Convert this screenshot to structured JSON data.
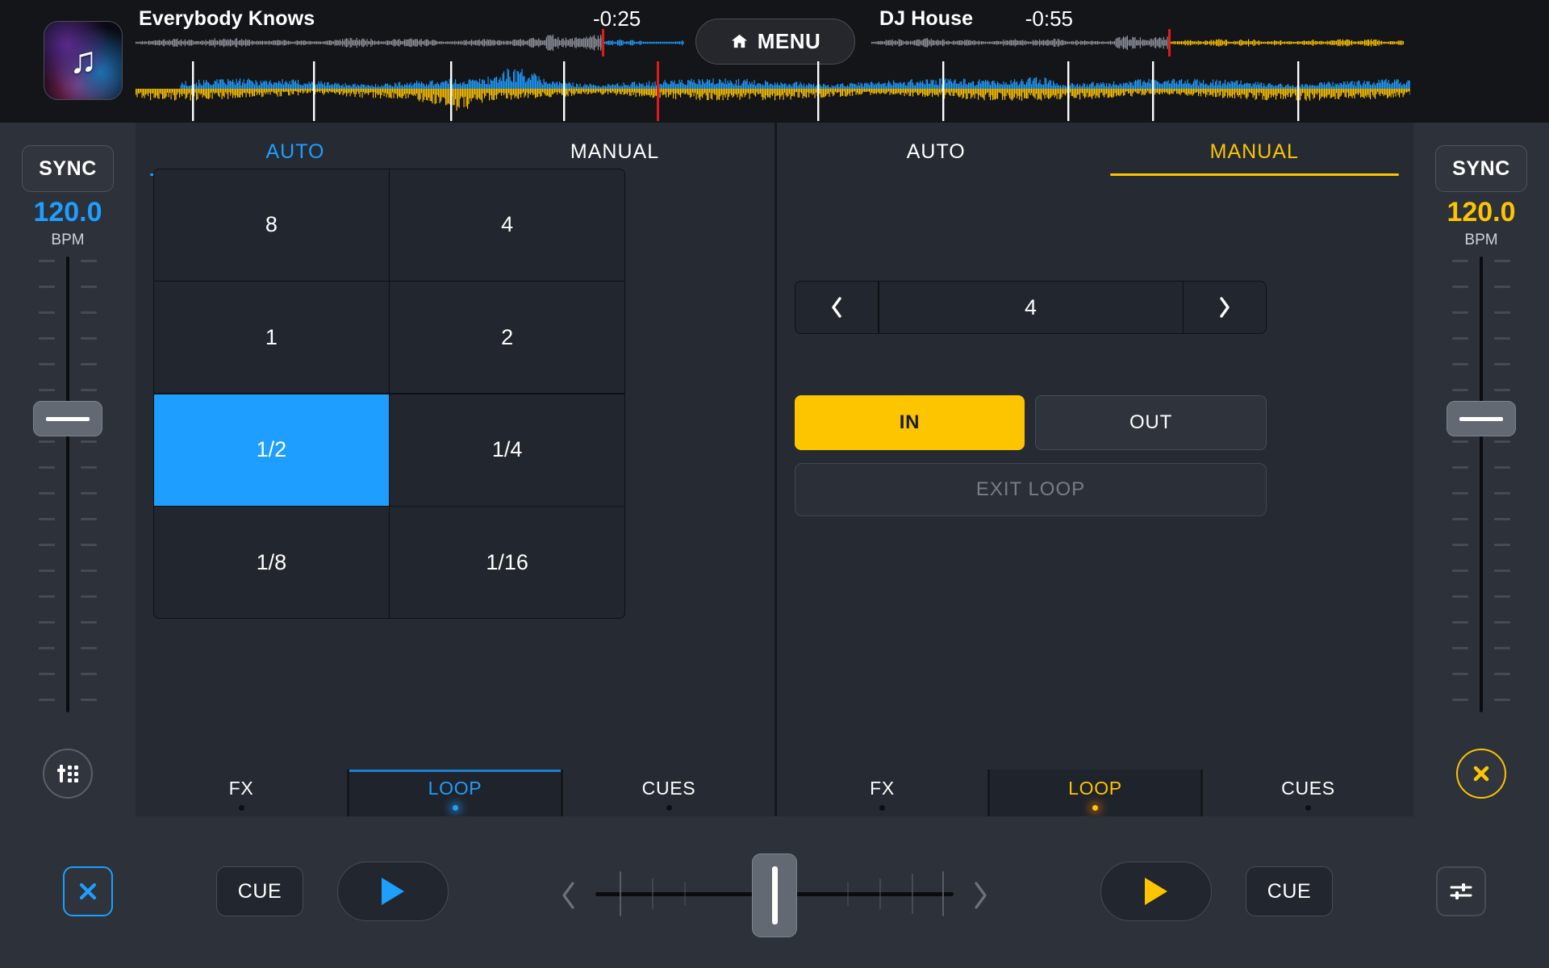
{
  "header": {
    "menu_label": "MENU",
    "menu_icon": "home-icon",
    "left_deck": {
      "title": "Everybody Knows",
      "time_remaining": "-0:25",
      "artwork_icon": "music-note-icon"
    },
    "right_deck": {
      "title": "DJ House",
      "time_remaining": "-0:55",
      "artwork_icon": "music-note-icon"
    }
  },
  "left_rail": {
    "sync_label": "SYNC",
    "bpm_value": "120.0",
    "bpm_label": "BPM",
    "pitch_slider_name": "pitch-fader",
    "bottom_icon": "pad-grid-icon",
    "accent": "#1e9eff"
  },
  "right_rail": {
    "sync_label": "SYNC",
    "bpm_value": "120.0",
    "bpm_label": "BPM",
    "pitch_slider_name": "pitch-fader",
    "bottom_icon": "close-circle-icon",
    "accent": "#fdc400"
  },
  "left_deck": {
    "mode_tabs": [
      {
        "label": "AUTO",
        "active": true
      },
      {
        "label": "MANUAL",
        "active": false
      }
    ],
    "loop_grid": [
      {
        "label": "8",
        "selected": false
      },
      {
        "label": "4",
        "selected": false
      },
      {
        "label": "1",
        "selected": false
      },
      {
        "label": "2",
        "selected": false
      },
      {
        "label": "1/2",
        "selected": true
      },
      {
        "label": "1/4",
        "selected": false
      },
      {
        "label": "1/8",
        "selected": false
      },
      {
        "label": "1/16",
        "selected": false
      }
    ],
    "bottom_tabs": [
      {
        "label": "FX",
        "active": false
      },
      {
        "label": "LOOP",
        "active": true
      },
      {
        "label": "CUES",
        "active": false
      }
    ]
  },
  "right_deck": {
    "mode_tabs": [
      {
        "label": "AUTO",
        "active": false
      },
      {
        "label": "MANUAL",
        "active": true
      }
    ],
    "beat_stepper": {
      "prev_icon": "chevron-left-icon",
      "next_icon": "chevron-right-icon",
      "value": "4"
    },
    "loop_in_label": "IN",
    "loop_out_label": "OUT",
    "exit_loop_label": "EXIT LOOP",
    "bottom_tabs": [
      {
        "label": "FX",
        "active": false
      },
      {
        "label": "LOOP",
        "active": true
      },
      {
        "label": "CUES",
        "active": false
      }
    ]
  },
  "transport": {
    "left_close_icon": "close-icon",
    "left_cue_label": "CUE",
    "left_play_icon": "play-icon",
    "right_play_icon": "play-icon",
    "right_cue_label": "CUE",
    "right_mixer_icon": "mixer-sliders-icon",
    "crossfader_name": "crossfader",
    "crossfader_prev_icon": "chevron-left-icon",
    "crossfader_next_icon": "chevron-right-icon"
  },
  "colors": {
    "deck_a_accent": "#1e9eff",
    "deck_b_accent": "#fdc400",
    "panel_bg": "#262a33",
    "rail_bg": "#2c313a",
    "header_bg": "#141518"
  }
}
